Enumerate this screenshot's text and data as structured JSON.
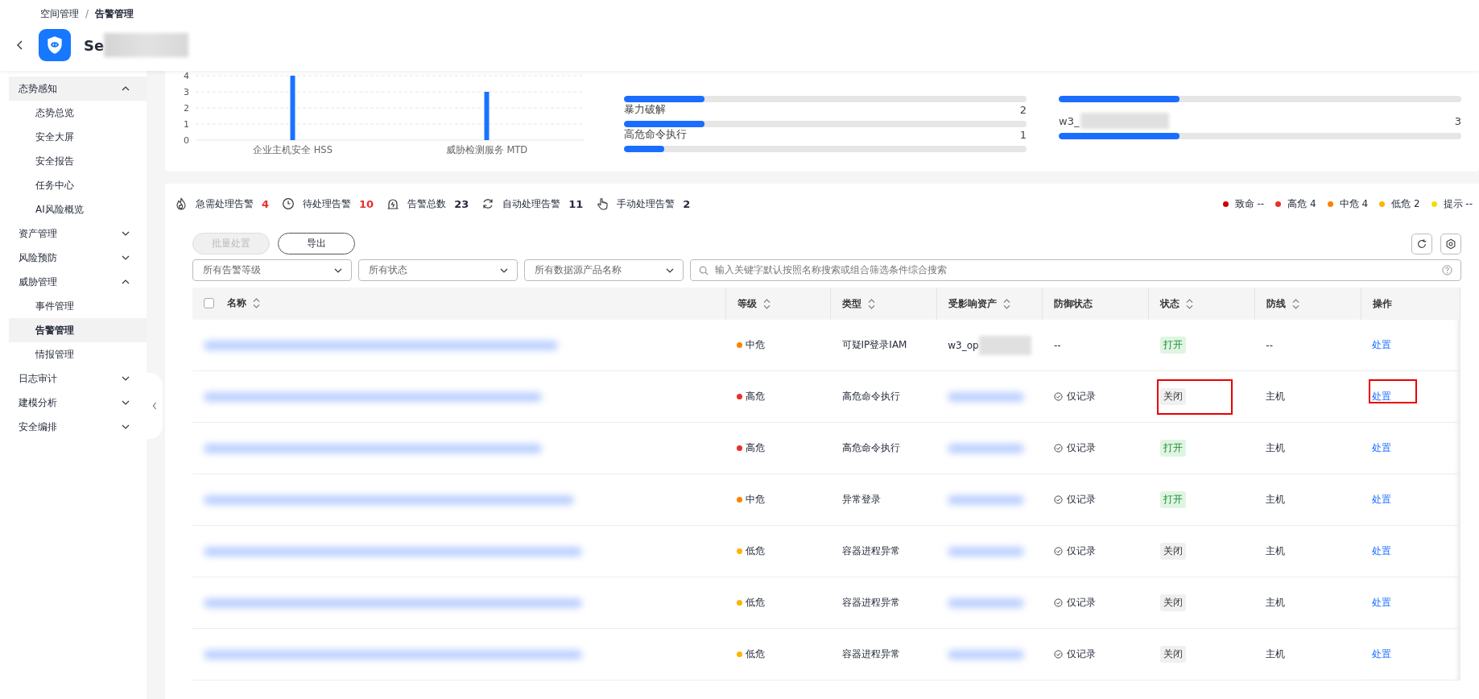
{
  "breadcrumb": {
    "items": [
      "空间管理",
      "告警管理"
    ],
    "separator": "/"
  },
  "app": {
    "title": "Se"
  },
  "sidebar": {
    "items": [
      {
        "label": "态势感知",
        "expanded": true,
        "hovered": true,
        "children": [
          {
            "label": "态势总览",
            "selected": false
          },
          {
            "label": "安全大屏",
            "selected": false
          },
          {
            "label": "安全报告",
            "selected": false
          },
          {
            "label": "任务中心",
            "selected": false
          },
          {
            "label": "AI风险概览",
            "selected": false
          }
        ]
      },
      {
        "label": "资产管理",
        "expanded": false,
        "hovered": false
      },
      {
        "label": "风险预防",
        "expanded": false,
        "hovered": false
      },
      {
        "label": "威胁管理",
        "expanded": true,
        "hovered": false,
        "children": [
          {
            "label": "事件管理",
            "selected": false
          },
          {
            "label": "告警管理",
            "selected": true
          },
          {
            "label": "情报管理",
            "selected": false
          }
        ]
      },
      {
        "label": "日志审计",
        "expanded": false,
        "hovered": false
      },
      {
        "label": "建模分析",
        "expanded": false,
        "hovered": false
      },
      {
        "label": "安全编排",
        "expanded": false,
        "hovered": false
      }
    ]
  },
  "overview": {
    "chart_data": {
      "type": "bar",
      "categories": [
        "企业主机安全 HSS",
        "威胁检测服务 MTD"
      ],
      "values": [
        4,
        3
      ],
      "ylim": [
        0,
        4
      ],
      "yticks": [
        0,
        1,
        2,
        3,
        4
      ],
      "grid": true,
      "color": "#1a73ff"
    },
    "type_list": [
      {
        "level": 0.2
      },
      {
        "label": "暴力破解",
        "count": "2",
        "level": 0.2
      },
      {
        "label": "高危命令执行",
        "count": "1",
        "level": 0.1
      }
    ],
    "asset_list": [
      {
        "level": 0.3
      },
      {
        "label": "w3_",
        "redacted": true,
        "count": "3",
        "level": 0.3
      }
    ]
  },
  "stats": [
    {
      "kind": "fire",
      "label": "急需处理告警",
      "value": "4",
      "alert": true
    },
    {
      "kind": "clock",
      "label": "待处理告警",
      "value": "10",
      "alert": true
    },
    {
      "kind": "total",
      "label": "告警总数",
      "value": "23",
      "alert": false
    },
    {
      "kind": "auto",
      "label": "自动处理告警",
      "value": "11",
      "alert": false
    },
    {
      "kind": "hand",
      "label": "手动处理告警",
      "value": "2",
      "alert": false
    }
  ],
  "severity_legend": [
    {
      "label": "致命 --",
      "color": "#c7000b"
    },
    {
      "label": "高危 4",
      "color": "#e8302c"
    },
    {
      "label": "中危 4",
      "color": "#ff8000"
    },
    {
      "label": "低危 2",
      "color": "#ffb400"
    },
    {
      "label": "提示 --",
      "color": "#f0e000"
    }
  ],
  "toolbar": {
    "buttons": [
      {
        "label": "批量处置",
        "disabled": true
      },
      {
        "label": "导出",
        "disabled": false
      }
    ]
  },
  "filters": [
    {
      "placeholder": "所有告警等级"
    },
    {
      "placeholder": "所有状态"
    },
    {
      "placeholder": "所有数据源产品名称"
    }
  ],
  "search": {
    "placeholder": "输入关键字默认按照名称搜索或组合筛选条件综合搜索"
  },
  "table": {
    "select_all": {
      "checked": false
    },
    "columns": [
      {
        "label": "名称",
        "sortable": true
      },
      {
        "label": "等级",
        "sortable": true
      },
      {
        "label": "类型",
        "sortable": true
      },
      {
        "label": "受影响资产",
        "sortable": true
      },
      {
        "label": "防御状态",
        "sortable": false
      },
      {
        "label": "状态",
        "sortable": true
      },
      {
        "label": "防线",
        "sortable": true
      },
      {
        "label": "操作",
        "sortable": false
      }
    ],
    "rows": [
      {
        "level": "中危",
        "color": "#ff8000",
        "type": "可疑IP登录IAM",
        "asset": "w3_op",
        "defense": "--",
        "logged": false,
        "status": "打开",
        "open": true,
        "line": "--",
        "action": "处置",
        "flag_status": false,
        "flag_action": false
      },
      {
        "level": "高危",
        "color": "#e8302c",
        "type": "高危命令执行",
        "defense": "仅记录",
        "logged": true,
        "status": "关闭",
        "open": false,
        "line": "主机",
        "action": "处置",
        "flag_status": true,
        "flag_action": true
      },
      {
        "level": "高危",
        "color": "#e8302c",
        "type": "高危命令执行",
        "defense": "仅记录",
        "logged": true,
        "status": "打开",
        "open": true,
        "line": "主机",
        "action": "处置",
        "flag_status": false,
        "flag_action": false
      },
      {
        "level": "中危",
        "color": "#ff8000",
        "type": "异常登录",
        "defense": "仅记录",
        "logged": true,
        "status": "打开",
        "open": true,
        "line": "主机",
        "action": "处置",
        "flag_status": false,
        "flag_action": false
      },
      {
        "level": "低危",
        "color": "#ffb400",
        "type": "容器进程异常",
        "defense": "仅记录",
        "logged": true,
        "status": "关闭",
        "open": false,
        "line": "主机",
        "action": "处置",
        "flag_status": false,
        "flag_action": false
      },
      {
        "level": "低危",
        "color": "#ffb400",
        "type": "容器进程异常",
        "defense": "仅记录",
        "logged": true,
        "status": "关闭",
        "open": false,
        "line": "主机",
        "action": "处置",
        "flag_status": false,
        "flag_action": false
      },
      {
        "level": "低危",
        "color": "#ffb400",
        "type": "容器进程异常",
        "defense": "仅记录",
        "logged": true,
        "status": "关闭",
        "open": false,
        "line": "主机",
        "action": "处置",
        "flag_status": false,
        "flag_action": false
      }
    ]
  }
}
